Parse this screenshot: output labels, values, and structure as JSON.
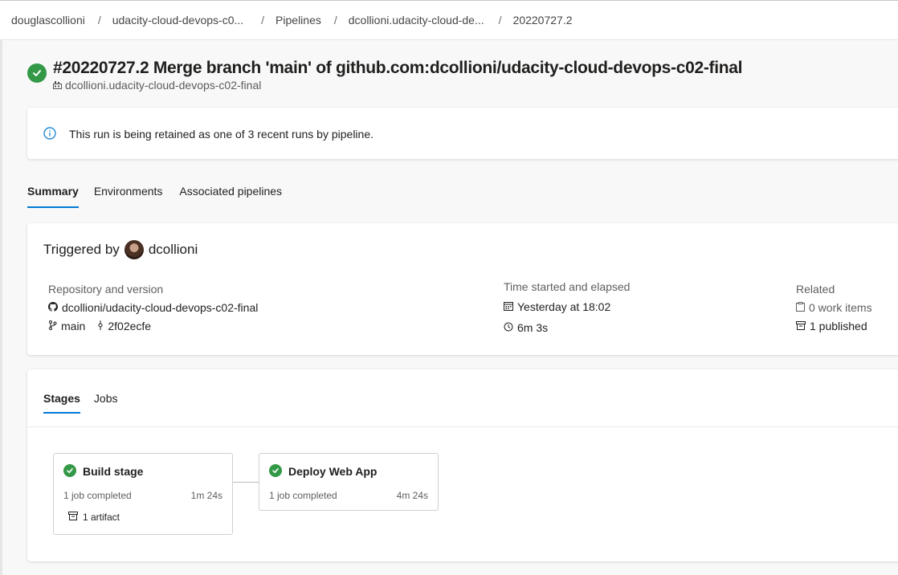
{
  "breadcrumb": {
    "items": [
      "douglascollioni",
      "udacity-cloud-devops-c0...",
      "Pipelines",
      "dcollioni.udacity-cloud-de...",
      "20220727.2"
    ],
    "separator": "/"
  },
  "run": {
    "title": "#20220727.2 Merge branch 'main' of github.com:dcollioni/udacity-cloud-devops-c02-final",
    "pipeline_name": "dcollioni.udacity-cloud-devops-c02-final",
    "status": "succeeded",
    "status_color": "#339947"
  },
  "info_banner": {
    "text": "This run is being retained as one of 3 recent runs by pipeline."
  },
  "tabs": [
    {
      "label": "Summary",
      "active": true
    },
    {
      "label": "Environments",
      "active": false
    },
    {
      "label": "Associated pipelines",
      "active": false
    }
  ],
  "summary": {
    "triggered_label": "Triggered by",
    "triggered_user": "dcollioni",
    "repo": {
      "heading": "Repository and version",
      "name": "dcollioni/udacity-cloud-devops-c02-final",
      "branch": "main",
      "commit": "2f02ecfe"
    },
    "time": {
      "heading": "Time started and elapsed",
      "started": "Yesterday at 18:02",
      "elapsed": "6m 3s"
    },
    "related": {
      "heading": "Related",
      "work_items": "0 work items",
      "published": "1 published"
    }
  },
  "stages_section": {
    "tabs": [
      {
        "label": "Stages",
        "active": true
      },
      {
        "label": "Jobs",
        "active": false
      }
    ],
    "stages": [
      {
        "name": "Build stage",
        "jobs": "1 job completed",
        "duration": "1m 24s",
        "artifact": "1 artifact"
      },
      {
        "name": "Deploy Web App",
        "jobs": "1 job completed",
        "duration": "4m 24s"
      }
    ]
  },
  "colors": {
    "accent": "#0078d4",
    "success": "#339947"
  }
}
